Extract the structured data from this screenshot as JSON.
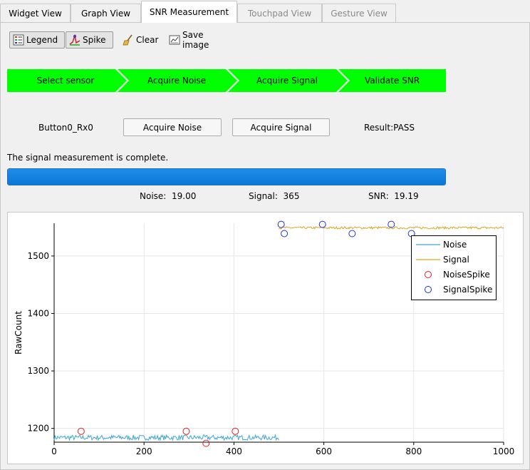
{
  "tabs": [
    {
      "label": "Widget View",
      "state": "normal"
    },
    {
      "label": "Graph View",
      "state": "normal"
    },
    {
      "label": "SNR Measurement",
      "state": "active"
    },
    {
      "label": "Touchpad View",
      "state": "disabled"
    },
    {
      "label": "Gesture View",
      "state": "disabled"
    }
  ],
  "toolbar": {
    "legend_label": "Legend",
    "spike_label": "Spike",
    "clear_label": "Clear",
    "save_label": "Save image"
  },
  "steps": [
    "Select sensor",
    "Acquire Noise",
    "Acquire Signal",
    "Validate SNR"
  ],
  "step_color": "#00ff00",
  "sensor_name": "Button0_Rx0",
  "buttons": {
    "acquire_noise": "Acquire Noise",
    "acquire_signal": "Acquire Signal"
  },
  "result": "Result:PASS",
  "status_message": "The signal measurement is complete.",
  "progress_fraction": 1.0,
  "stats": {
    "noise_label": "Noise:",
    "noise_value": "19.00",
    "signal_label": "Signal:",
    "signal_value": "365",
    "snr_label": "SNR:",
    "snr_value": "19.19"
  },
  "chart_data": {
    "type": "line",
    "ylabel": "RawCount",
    "xlabel": "",
    "xlim": [
      0,
      1000
    ],
    "ylim": [
      1176,
      1557
    ],
    "xticks": [
      "0",
      "200",
      "400",
      "600",
      "800",
      "1000"
    ],
    "yticks": [
      "1200",
      "1300",
      "1400",
      "1500"
    ],
    "grid": true,
    "legend_placement": "top-right",
    "series": [
      {
        "name": "Noise",
        "color": "#3ca6d4",
        "x_range": [
          0,
          500
        ],
        "mean": 1184,
        "spread": 9
      },
      {
        "name": "Signal",
        "color": "#d9a520",
        "x_range": [
          500,
          1000
        ],
        "mean": 1549,
        "spread": 4
      },
      {
        "name": "NoiseSpike",
        "color": "#e02020",
        "marker": "circle",
        "points": [
          [
            60,
            1195
          ],
          [
            294,
            1195
          ],
          [
            338,
            1174
          ],
          [
            403,
            1195
          ]
        ]
      },
      {
        "name": "SignalSpike",
        "color": "#1f30d0",
        "marker": "circle",
        "points": [
          [
            505,
            1555
          ],
          [
            512,
            1539
          ],
          [
            597,
            1555
          ],
          [
            663,
            1539
          ],
          [
            750,
            1555
          ],
          [
            795,
            1539
          ]
        ]
      }
    ]
  }
}
